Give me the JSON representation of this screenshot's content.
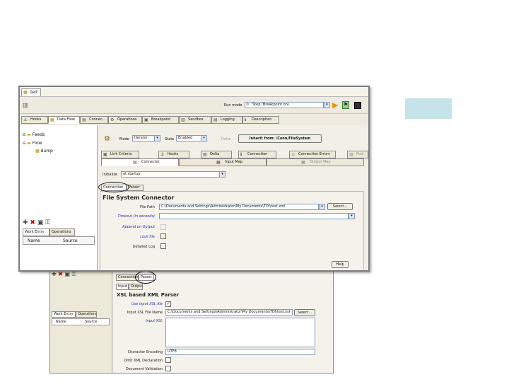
{
  "front_window": {
    "tab_label": "ted",
    "toolbar": {
      "run_mode_label": "Run mode",
      "run_mode_value": "Step (Breakpoint on)"
    },
    "nav_tabs": [
      "Hooks",
      "Data Flow",
      "Connec...",
      "Operations",
      "Breakpoint",
      "Sandbox",
      "Logging",
      "Description"
    ],
    "tree": {
      "items": [
        "Feeds",
        "Flow",
        "dump"
      ]
    },
    "lower_left": {
      "tabs": [
        "Work Entry",
        "Operations"
      ],
      "columns": [
        "Name",
        "Source"
      ]
    },
    "connector_row": {
      "mode_label": "Mode",
      "mode_value": "Iterator",
      "state_label": "State",
      "state_value": "Enabled",
      "delta_label": "Delta",
      "inherit_button": "Inherit from: /Conn/FileSystem"
    },
    "sub_tabs_row1": [
      "Link Criteria",
      "Hooks",
      "Delta",
      "Connection",
      "Connection Errors",
      "Pool"
    ],
    "sub_tabs_row2": [
      "Connector",
      "Input Map",
      "Output Map"
    ],
    "initialize_label": "Initialize",
    "initialize_value": "at startup",
    "inner_tabs": [
      "Connection",
      "Parser"
    ],
    "section_title": "File System Connector",
    "fields": {
      "file_path_label": "File Path",
      "file_path_value": "C:\\Documents and Settings\\Administrator\\My Documents\\TDI\\test.xml",
      "select_button": "Select...",
      "timeout_label": "Timeout (in seconds)",
      "append_label": "Append on Output",
      "lock_label": "Lock file",
      "detailed_log_label": "Detailed Log",
      "help_button": "Help"
    }
  },
  "back_window": {
    "left_tabs": [
      "Work Entry",
      "Operations"
    ],
    "columns": [
      "Name",
      "Source"
    ],
    "inner_tabs": [
      "Connection",
      "Parser"
    ],
    "io_tabs": [
      "Input",
      "Output"
    ],
    "section_title": "XSL based XML Parser",
    "fields": {
      "use_input_xsl_label": "Use input XSL file",
      "input_xsl_file_label": "Input XSL File Name",
      "input_xsl_file_value": "C:\\Documents and Settings\\Administrator\\My Documents\\TDI\\test.xsl",
      "select_button": "Select...",
      "input_xsl_label": "Input XSL",
      "char_encoding_label": "Character Encoding",
      "char_encoding_value": "UTF8",
      "omit_xml_declaration_label": "Omit XML Declaration",
      "document_validation_label": "Document Validation"
    }
  },
  "colors": {
    "accent_box": "#c6e3ea",
    "link_label": "#1a2fbf"
  }
}
